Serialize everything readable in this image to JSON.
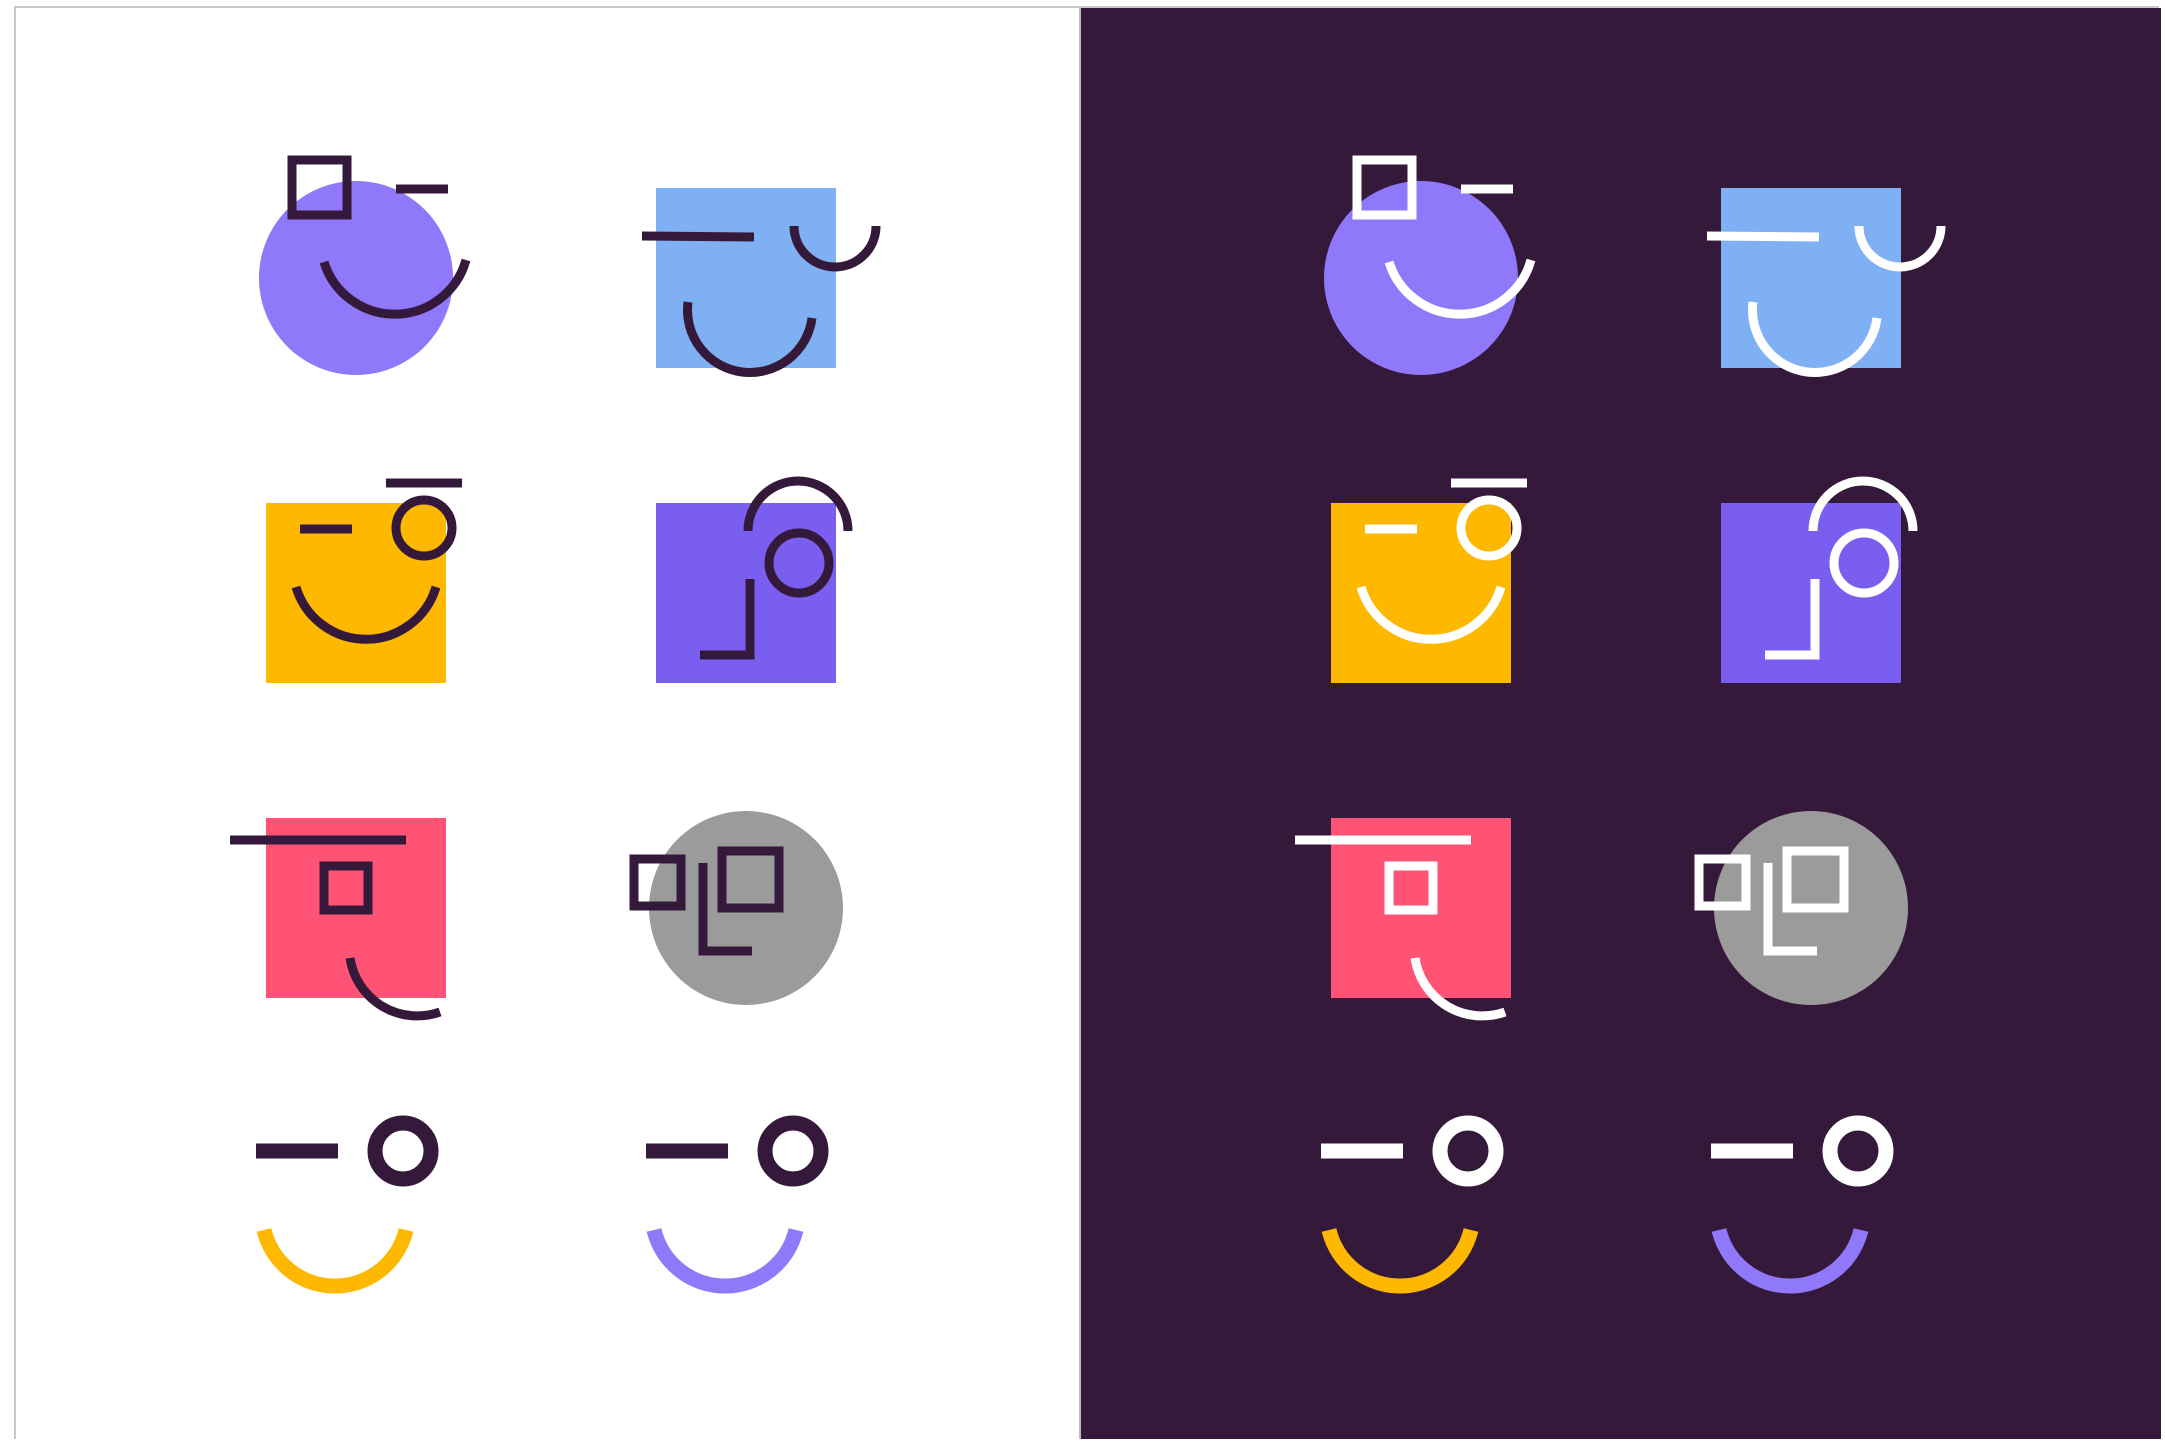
{
  "colors": {
    "ink": "#35193a",
    "white": "#ffffff",
    "violet": "#8f78fa",
    "sky": "#80b0f4",
    "amber": "#ffb800",
    "indigo": "#7a5ef0",
    "coral": "#ff5376",
    "gray": "#9b9b9b",
    "dark_bg": "#35193a",
    "light_bg": "#ffffff"
  },
  "panels": [
    {
      "theme": "light",
      "stroke": "#35193a"
    },
    {
      "theme": "dark",
      "stroke": "#ffffff"
    }
  ],
  "icons": [
    {
      "name": "smile-circle-violet-icon",
      "shape": "circle",
      "fill": "#8f78fa"
    },
    {
      "name": "wink-square-sky-icon",
      "shape": "square",
      "fill": "#80b0f4"
    },
    {
      "name": "smile-square-amber-icon",
      "shape": "square",
      "fill": "#ffb800"
    },
    {
      "name": "curious-square-indigo-icon",
      "shape": "square",
      "fill": "#7a5ef0"
    },
    {
      "name": "smirk-square-coral-icon",
      "shape": "square",
      "fill": "#ff5376"
    },
    {
      "name": "surprised-circle-gray-icon",
      "shape": "circle",
      "fill": "#9b9b9b"
    },
    {
      "name": "wink-outline-amber-icon",
      "shape": "none",
      "smile": "#ffb800"
    },
    {
      "name": "wink-outline-violet-icon",
      "shape": "none",
      "smile": "#8f78fa"
    }
  ]
}
